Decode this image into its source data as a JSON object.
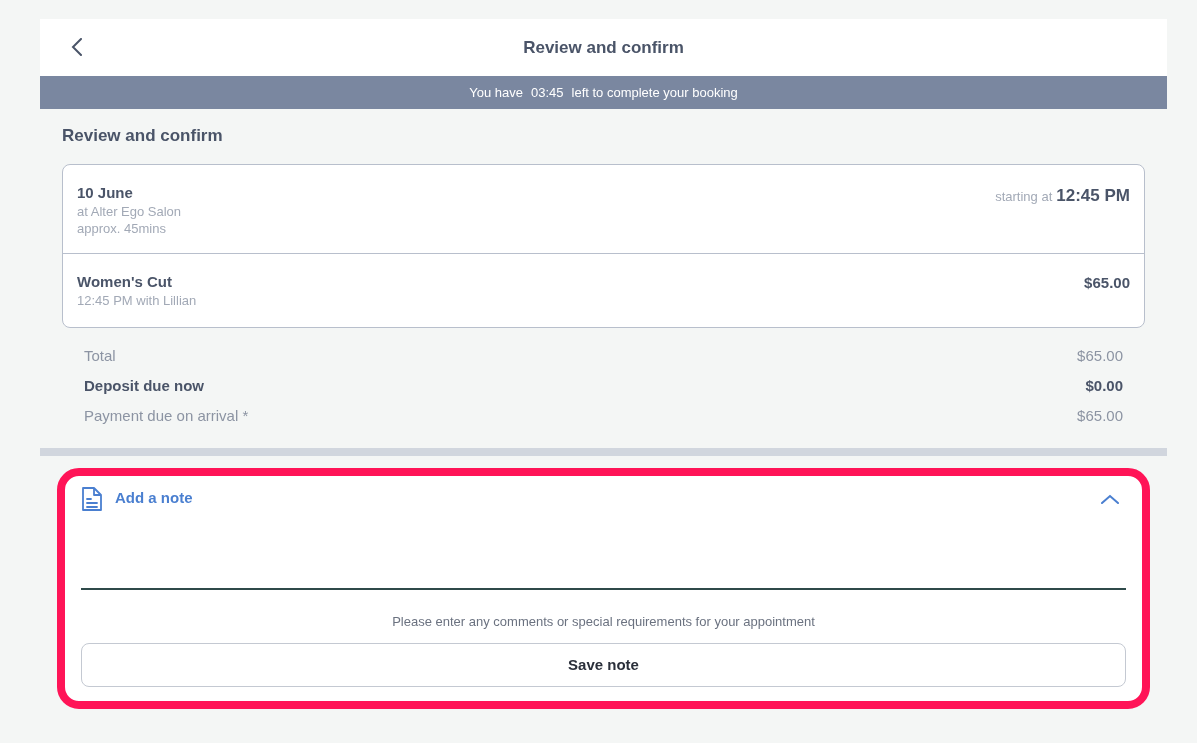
{
  "header": {
    "title": "Review and confirm"
  },
  "timer": {
    "prefix": "You have",
    "time": "03:45",
    "suffix": "left to complete your booking"
  },
  "section_title": "Review and confirm",
  "appointment": {
    "date": "10 June",
    "location": "at Alter Ego Salon",
    "duration": "approx. 45mins",
    "start_label": "starting at",
    "start_time": "12:45 PM"
  },
  "services": [
    {
      "name": "Women's Cut",
      "detail": "12:45 PM with Lillian",
      "price": "$65.00"
    }
  ],
  "totals": [
    {
      "label": "Total",
      "value": "$65.00",
      "bold": false
    },
    {
      "label": "Deposit due now",
      "value": "$0.00",
      "bold": true
    },
    {
      "label": "Payment due on arrival *",
      "value": "$65.00",
      "bold": false
    }
  ],
  "note": {
    "title": "Add a note",
    "expanded": true,
    "hint": "Please enter any comments or special requirements for your appointment",
    "button": "Save note"
  }
}
